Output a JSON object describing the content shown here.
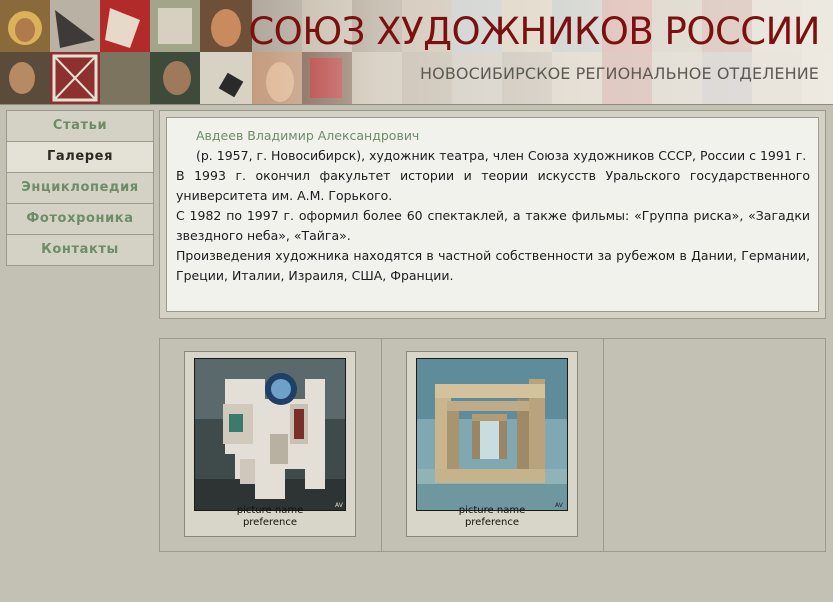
{
  "header": {
    "title": "СОЮЗ ХУДОЖНИКОВ РОССИИ",
    "subtitle": "НОВОСИБИРСКОЕ РЕГИОНАЛЬНОЕ ОТДЕЛЕНИЕ",
    "title_color": "#7c1010"
  },
  "nav": {
    "items": [
      {
        "label": "Статьи",
        "active": false
      },
      {
        "label": "Галерея",
        "active": true
      },
      {
        "label": "Энциклопедия",
        "active": false
      },
      {
        "label": "Фотохроника",
        "active": false
      },
      {
        "label": "Контакты",
        "active": false
      }
    ],
    "link_color": "#6e8c68"
  },
  "bio": {
    "name": "Авдеев Владимир Александрович",
    "paragraphs": [
      "(р. 1957, г. Новосибирск), художник театра, член Союза художников СССР, России с 1991 г.",
      "В 1993 г. окончил факультет истории и теории искусств Уральского государственного университета им. А.М. Горького.",
      "С 1982 по 1997 г. оформил более 60 спектаклей, а также фильмы: «Группа риска», «Загадки звездного неба», «Тайга».",
      "Произведения художника находятся в частной собственности за рубежом в Дании, Германии, Греции, Италии, Израиля, США, Франции."
    ]
  },
  "gallery": {
    "items": [
      {
        "caption_line1": "picture name",
        "caption_line2": "preference",
        "image": "painting-abstract-architecture"
      },
      {
        "caption_line1": "picture name",
        "caption_line2": "preference",
        "image": "painting-wooden-frame-structure"
      }
    ]
  }
}
